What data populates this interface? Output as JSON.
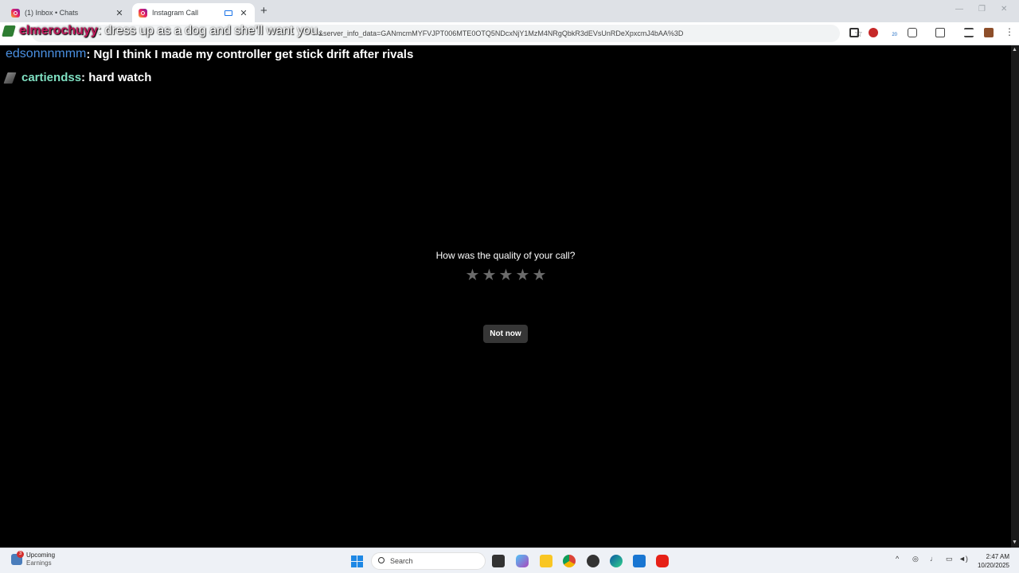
{
  "browser": {
    "tabs": [
      {
        "title": "(1) Inbox • Chats",
        "active": false
      },
      {
        "title": "Instagram Call",
        "active": true
      }
    ],
    "new_tab_icon": "+",
    "url": "&server_info_data=GANmcmMYFVJPT006MTE0OTQ5NDcxNjY1MzM4NRgQbkR3dEVsUnRDeXpxcmJ4bAA%3D",
    "extension_badge": "20"
  },
  "chat_overlay": [
    {
      "user": "elmerochuyy",
      "message": ": dress up as a dog and she'll want you."
    },
    {
      "user": "edsonnnmmm",
      "message": " : Ngl I think I made my controller get stick drift after rivals"
    },
    {
      "user": "cartiendss",
      "message": " : hard watch"
    }
  ],
  "call_rating": {
    "question": "How was the quality of your call?",
    "star_count": 5,
    "star_glyph": "★",
    "not_now_label": "Not now"
  },
  "taskbar": {
    "weather_badge": "3",
    "weather_title": "Upcoming",
    "weather_sub": "Earnings",
    "search_placeholder": "Search",
    "time": "2:47 AM",
    "date": "10/20/2025"
  },
  "colors": {
    "star_inactive": "#6b6b6b",
    "button_bg": "#363636",
    "user_pink": "#c2185b",
    "user_blue": "#4a90e2",
    "user_teal": "#7fe0c2"
  }
}
